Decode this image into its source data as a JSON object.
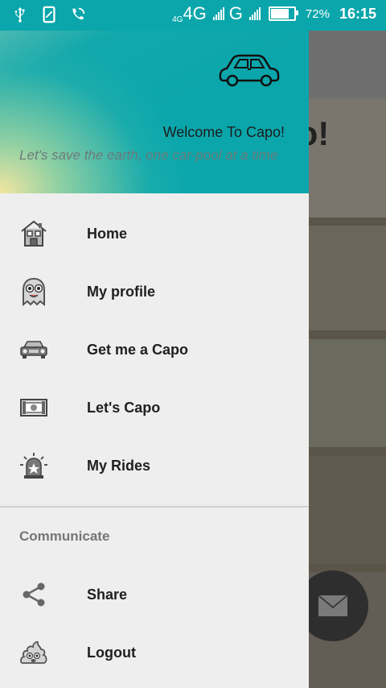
{
  "statusbar": {
    "network_small": "4G",
    "network_main": "4G",
    "network_secondary": "G",
    "battery_percent": "72%",
    "time": "16:15",
    "battery_level": 0.72
  },
  "header": {
    "welcome": "Welcome To Capo!",
    "tagline": "Let's save the earth, one car-pool at a time"
  },
  "menu": {
    "items": [
      {
        "label": "Home",
        "icon": "house-icon"
      },
      {
        "label": "My profile",
        "icon": "ghost-icon"
      },
      {
        "label": "Get me a Capo",
        "icon": "car-icon"
      },
      {
        "label": "Let's Capo",
        "icon": "money-icon"
      },
      {
        "label": "My Rides",
        "icon": "siren-icon"
      }
    ],
    "section_title": "Communicate",
    "communicate_items": [
      {
        "label": "Share",
        "icon": "share-icon"
      },
      {
        "label": "Logout",
        "icon": "poop-icon"
      }
    ]
  },
  "background": {
    "title_fragment": "po!"
  },
  "colors": {
    "accent": "#0aa6ab",
    "drawer_bg": "#eeeeee",
    "text": "#202020",
    "section_text": "#757575"
  }
}
